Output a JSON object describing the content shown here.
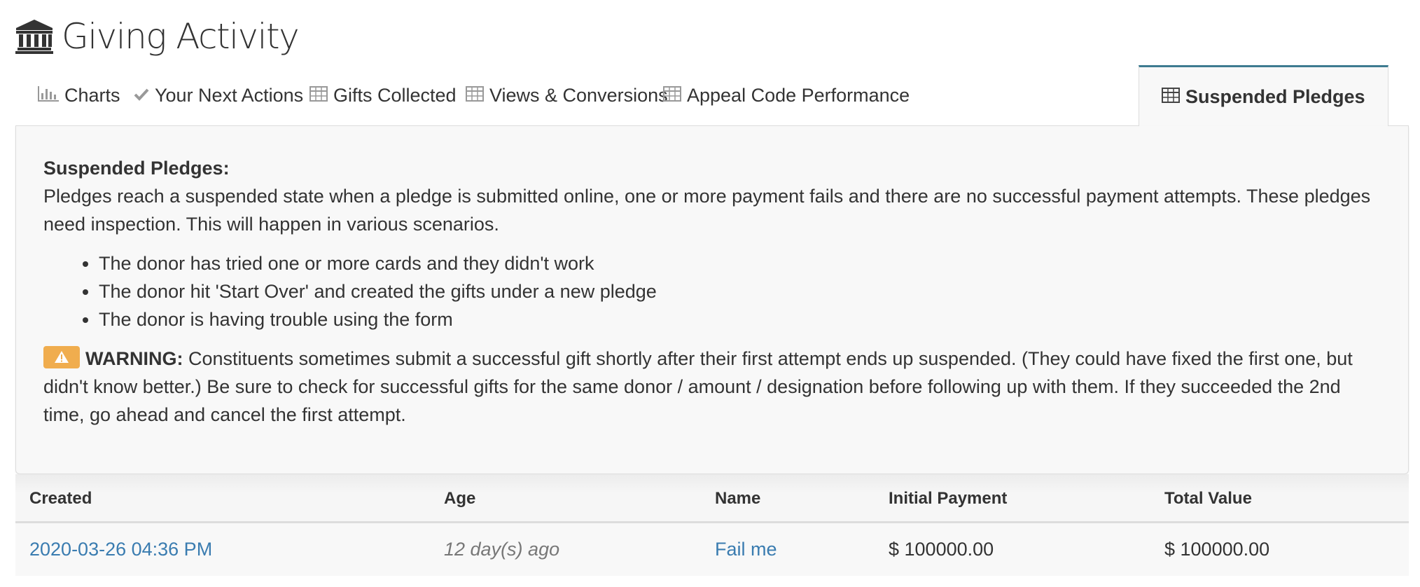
{
  "header": {
    "title": "Giving Activity",
    "icon": "bank-icon"
  },
  "tabs": [
    {
      "label": "Charts",
      "icon": "bar-chart-icon",
      "active": false
    },
    {
      "label": "Your Next Actions",
      "icon": "check-icon",
      "active": false
    },
    {
      "label": "Gifts Collected",
      "icon": "table-icon",
      "active": false
    },
    {
      "label": "Views & Conversions",
      "icon": "table-icon",
      "active": false
    },
    {
      "label": "Appeal Code Performance",
      "icon": "table-icon",
      "active": false
    },
    {
      "label": "Suspended Pledges",
      "icon": "table-icon",
      "active": true
    }
  ],
  "panel": {
    "heading": "Suspended Pledges:",
    "intro": "Pledges reach a suspended state when a pledge is submitted online, one or more payment fails and there are no successful payment attempts. These pledges need inspection. This will happen in various scenarios.",
    "scenarios": [
      "The donor has tried one or more cards and they didn't work",
      "The donor hit 'Start Over' and created the gifts under a new pledge",
      "The donor is having trouble using the form"
    ],
    "warning_label": "WARNING:",
    "warning_text": " Constituents sometimes submit a successful gift shortly after their first attempt ends up suspended. (They could have fixed the first one, but didn't know better.) Be sure to check for successful gifts for the same donor / amount / designation before following up with them. If they succeeded the 2nd time, go ahead and cancel the first attempt.",
    "warning_color": "#f0ad4e"
  },
  "table": {
    "columns": [
      "Created",
      "Age",
      "Name",
      "Initial Payment",
      "Total Value"
    ],
    "rows": [
      {
        "created": "2020-03-26 04:36 PM",
        "age": "12 day(s) ago",
        "name": "Fail me",
        "initial_payment": "$ 100000.00",
        "total_value": "$ 100000.00"
      }
    ]
  },
  "colors": {
    "link": "#3a7cb0",
    "active_tab_border": "#3d7b90"
  }
}
